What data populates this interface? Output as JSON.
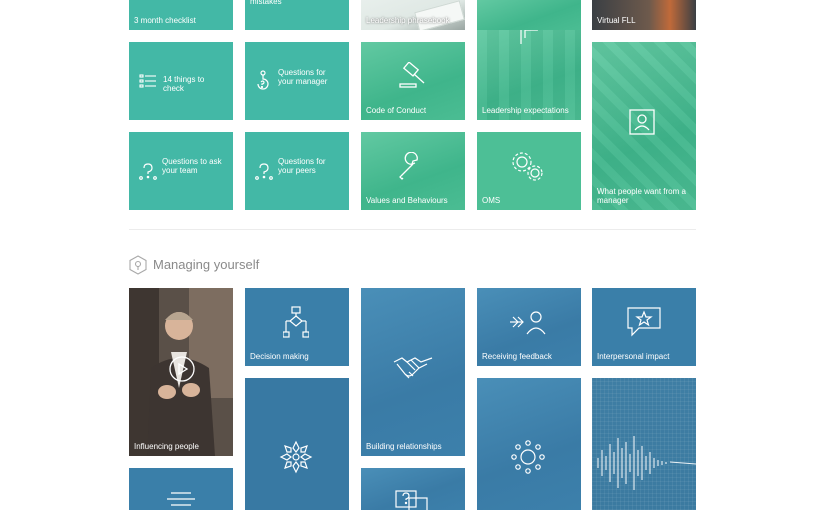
{
  "tiles_top": {
    "checklist_3m": "3 month checklist",
    "mistakes": "mistakes",
    "phrasebook": "Leadership phrasebook",
    "virtual": "Virtual FLL",
    "things14": "14 things to check",
    "q_manager": "Questions for your manager",
    "code_conduct": "Code of Conduct",
    "leadership_exp": "Leadership expectations",
    "what_people": "What people want from a manager",
    "q_team": "Questions to ask your team",
    "q_peers": "Questions for your peers",
    "values": "Values and Behaviours",
    "oms": "OMS"
  },
  "section": {
    "title": "Managing yourself"
  },
  "tiles_bottom": {
    "influencing": "Influencing people",
    "decision": "Decision making",
    "building": "Building relationships",
    "receiving": "Receiving feedback",
    "interpersonal": "Interpersonal impact"
  },
  "colors": {
    "teal": "#43b8a6",
    "green": "#4dbf96",
    "blue": "#3a7fa9",
    "divider": "#ececec",
    "section_text": "#8a8a8a"
  },
  "icons": [
    "list-icon",
    "hook-question-icon",
    "gavel-icon",
    "flag-person-icon",
    "person-frame-icon",
    "question-bubble-icon",
    "wrench-icon",
    "gears-icon",
    "flowchart-icon",
    "handshake-icon",
    "arrow-person-icon",
    "star-speech-icon",
    "snowflake-icon",
    "sun-network-icon",
    "lines-icon",
    "question-chat-icon",
    "play-icon",
    "lightbulb-hex-icon"
  ]
}
